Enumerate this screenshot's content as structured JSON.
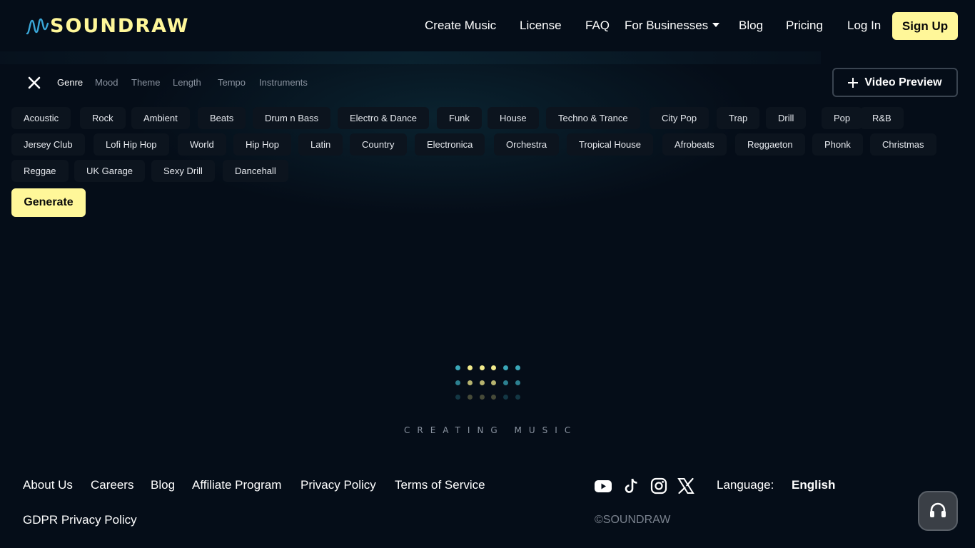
{
  "brand": {
    "logo_text": "SOUNDRAW",
    "accent": "#fff799",
    "background": "#050d18"
  },
  "nav": {
    "create_music": "Create Music",
    "license": "License",
    "faq": "FAQ",
    "for_businesses": "For Businesses",
    "blog": "Blog",
    "pricing": "Pricing",
    "login": "Log In",
    "signup": "Sign Up"
  },
  "filters": {
    "close_icon": "close-icon",
    "tabs": [
      {
        "label": "Genre",
        "active": true
      },
      {
        "label": "Mood",
        "active": false
      },
      {
        "label": "Theme",
        "active": false
      },
      {
        "label": "Length",
        "active": false
      },
      {
        "label": "Tempo",
        "active": false
      },
      {
        "label": "Instruments",
        "active": false
      }
    ],
    "video_preview": "Video Preview"
  },
  "genres": [
    "Acoustic",
    "Rock",
    "Ambient",
    "Beats",
    "Drum n Bass",
    "Electro & Dance",
    "Funk",
    "House",
    "Techno & Trance",
    "City Pop",
    "Trap",
    "Drill",
    "Pop",
    "R&B",
    "Jersey Club",
    "Lofi Hip Hop",
    "World",
    "Hip Hop",
    "Latin",
    "Country",
    "Electronica",
    "Orchestra",
    "Tropical House",
    "Afrobeats",
    "Reggaeton",
    "Phonk",
    "Christmas",
    "Reggae",
    "UK Garage",
    "Sexy Drill",
    "Dancehall"
  ],
  "generate_label": "Generate",
  "loader": {
    "text": "CREATING MUSIC",
    "colors": {
      "teal": "#3aa7b8",
      "yellow": "#f2eb8c"
    }
  },
  "footer": {
    "links": [
      "About Us",
      "Careers",
      "Blog",
      "Affiliate Program",
      "Privacy Policy",
      "Terms of Service"
    ],
    "gdpr": "GDPR Privacy Policy",
    "social_icons": [
      "youtube-icon",
      "tiktok-icon",
      "instagram-icon",
      "x-icon"
    ],
    "language_label": "Language:",
    "language_value": "English",
    "copyright": "©SOUNDRAW"
  }
}
